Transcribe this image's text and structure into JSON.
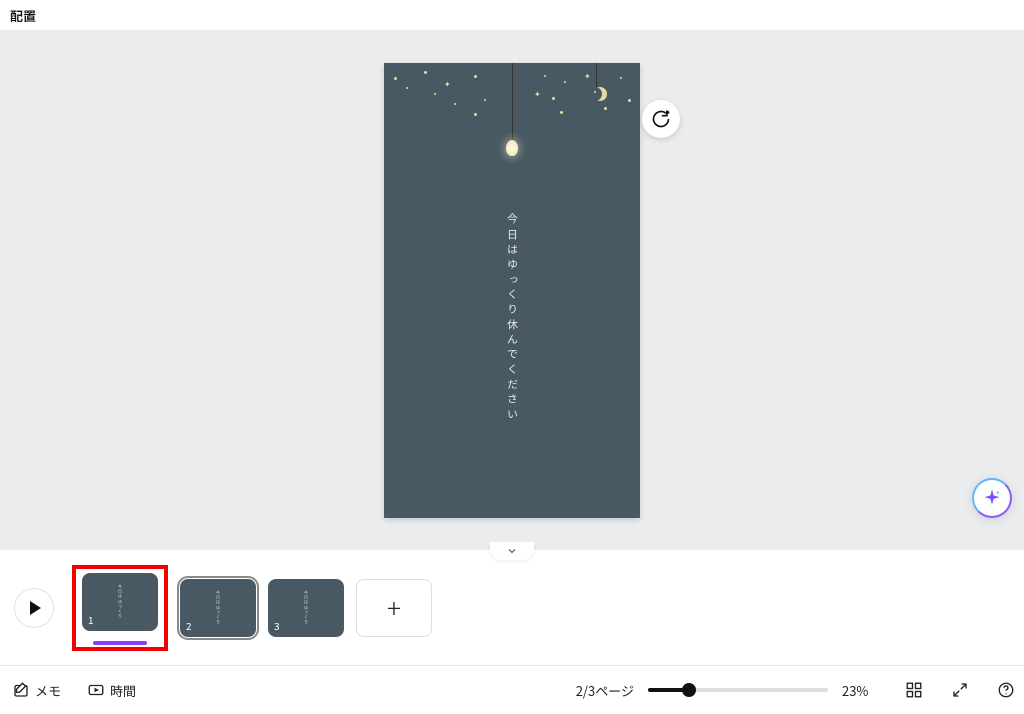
{
  "toolbar": {
    "position_label": "配置"
  },
  "canvas": {
    "vertical_text": "今日はゆっくり休んでください",
    "bg_color": "#495963",
    "accent_color": "#e8d9a0"
  },
  "floating": {
    "refresh_icon": "refresh-plus",
    "magic_icon": "sparkle"
  },
  "thumbnails": {
    "items": [
      {
        "num": "1",
        "selected": false,
        "highlighted": true
      },
      {
        "num": "2",
        "selected": true,
        "highlighted": false
      },
      {
        "num": "3",
        "selected": false,
        "highlighted": false
      }
    ],
    "add_label": "+"
  },
  "bottombar": {
    "notes_label": "メモ",
    "duration_label": "時間",
    "page_indicator": "2/3ページ",
    "zoom_percent": "23%",
    "zoom_value": 23
  },
  "icons": {
    "grid": "grid-view-icon",
    "fullscreen": "fullscreen-icon",
    "help": "help-icon"
  }
}
